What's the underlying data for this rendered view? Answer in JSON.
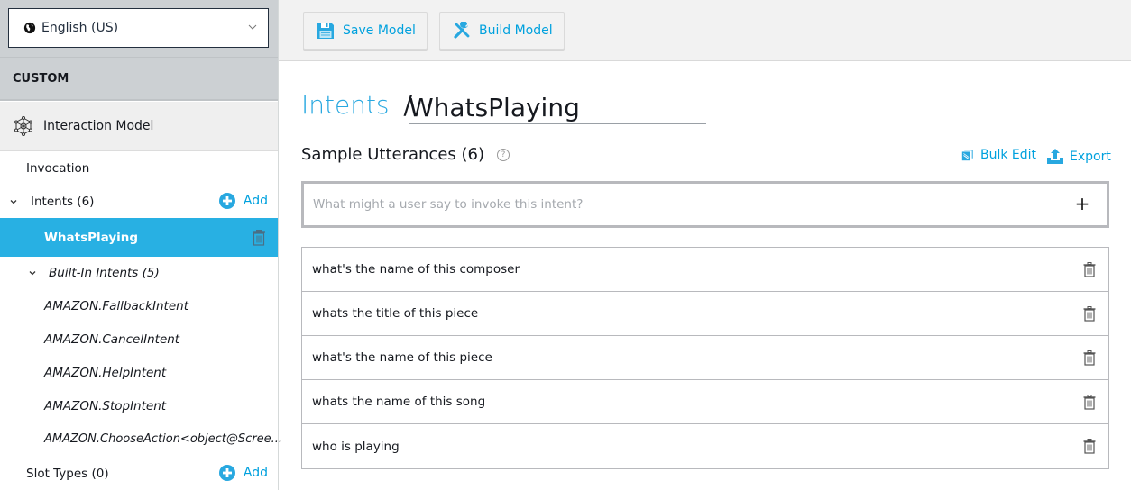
{
  "language_select": {
    "icon": "globe-icon",
    "value": "English (US)"
  },
  "sidebar": {
    "section_title": "CUSTOM",
    "interaction_model": {
      "icon": "network-icon",
      "label": "Interaction Model"
    },
    "invocation": "Invocation",
    "intents": {
      "label": "Intents (6)",
      "add_label": "Add"
    },
    "selected_intent": "WhatsPlaying",
    "builtin_header": "Built-In Intents (5)",
    "builtin_intents": [
      "AMAZON.FallbackIntent",
      "AMAZON.CancelIntent",
      "AMAZON.HelpIntent",
      "AMAZON.StopIntent",
      "AMAZON.ChooseAction<object@Scree..."
    ],
    "slot_types": {
      "label": "Slot Types (0)",
      "add_label": "Add"
    }
  },
  "toolbar": {
    "save_label": "Save Model",
    "build_label": "Build Model"
  },
  "main": {
    "breadcrumb_root": "Intents",
    "breadcrumb_separator": "/",
    "intent_name": "WhatsPlaying",
    "sample_utterances_title": "Sample Utterances (6)",
    "help_glyph": "?",
    "bulk_edit_label": "Bulk Edit",
    "export_label": "Export",
    "utterance_placeholder": "What might a user say to invoke this intent?",
    "add_glyph": "+",
    "utterances": [
      "what's the name of this composer",
      "whats the title of this piece",
      "what's the name of this piece",
      "whats the name of this song",
      "who is playing"
    ]
  },
  "colors": {
    "accent": "#00a1de",
    "selected_bg": "#28b0e3",
    "sidebar_header_bg": "#ccd0d3"
  }
}
